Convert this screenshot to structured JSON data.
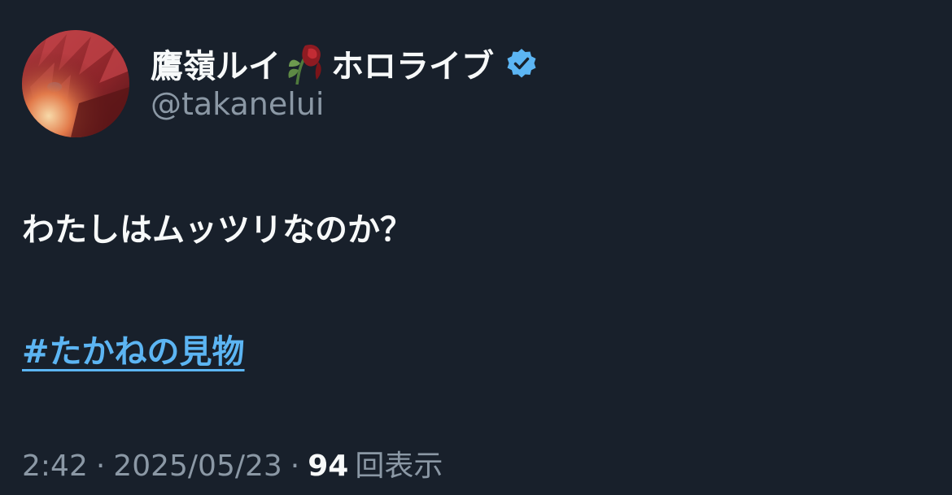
{
  "author": {
    "display_name": "鷹嶺ルイ",
    "affiliation": "ホロライブ",
    "name_emoji": "wilted-rose-icon",
    "verified_icon": "verified-badge-icon",
    "handle": "@takanelui",
    "avatar": "avatar-image"
  },
  "tweet": {
    "text": "わたしはムッツリなのか？",
    "hashtag": "#たかねの見物"
  },
  "meta": {
    "time": "2:42",
    "separator": "·",
    "date": "2025/05/23",
    "views_count": "94",
    "views_label": "回表示"
  },
  "colors": {
    "background": "#18202b",
    "text_primary": "#f7f9f9",
    "text_secondary": "#8b98a5",
    "link": "#5cb5f3",
    "verified": "#5cb5f3"
  }
}
